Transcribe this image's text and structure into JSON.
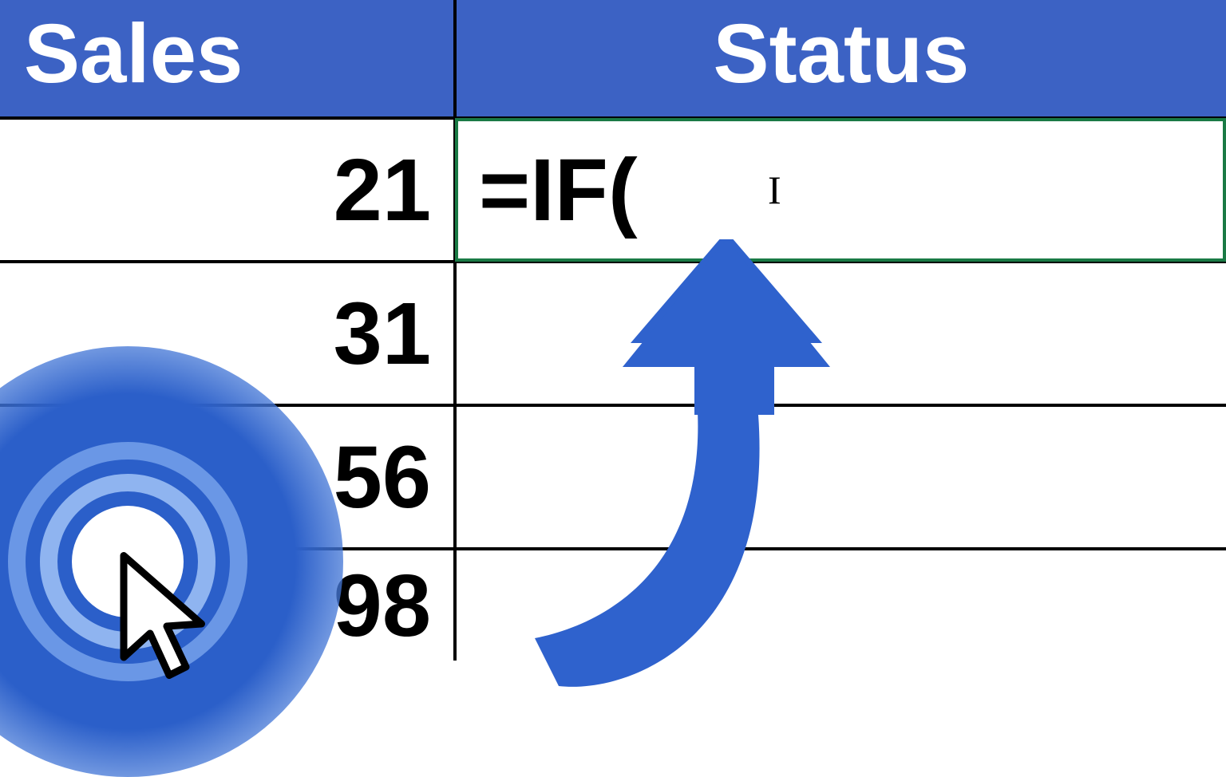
{
  "table": {
    "headers": {
      "sales": "Sales",
      "status": "Status"
    },
    "rows": [
      {
        "sales": "21",
        "status": "=IF("
      },
      {
        "sales": "31",
        "status": ""
      },
      {
        "sales": "56",
        "status": ""
      },
      {
        "sales": "98",
        "status": ""
      }
    ]
  },
  "colors": {
    "header_bg": "#3c62c4",
    "arrow": "#2f62cd",
    "active_border": "#1a7a45"
  },
  "icons": {
    "cursor": "cursor-arrow-icon",
    "target": "target-click-icon",
    "arrow": "curved-up-arrow-icon",
    "text_caret": "text-cursor-icon"
  }
}
